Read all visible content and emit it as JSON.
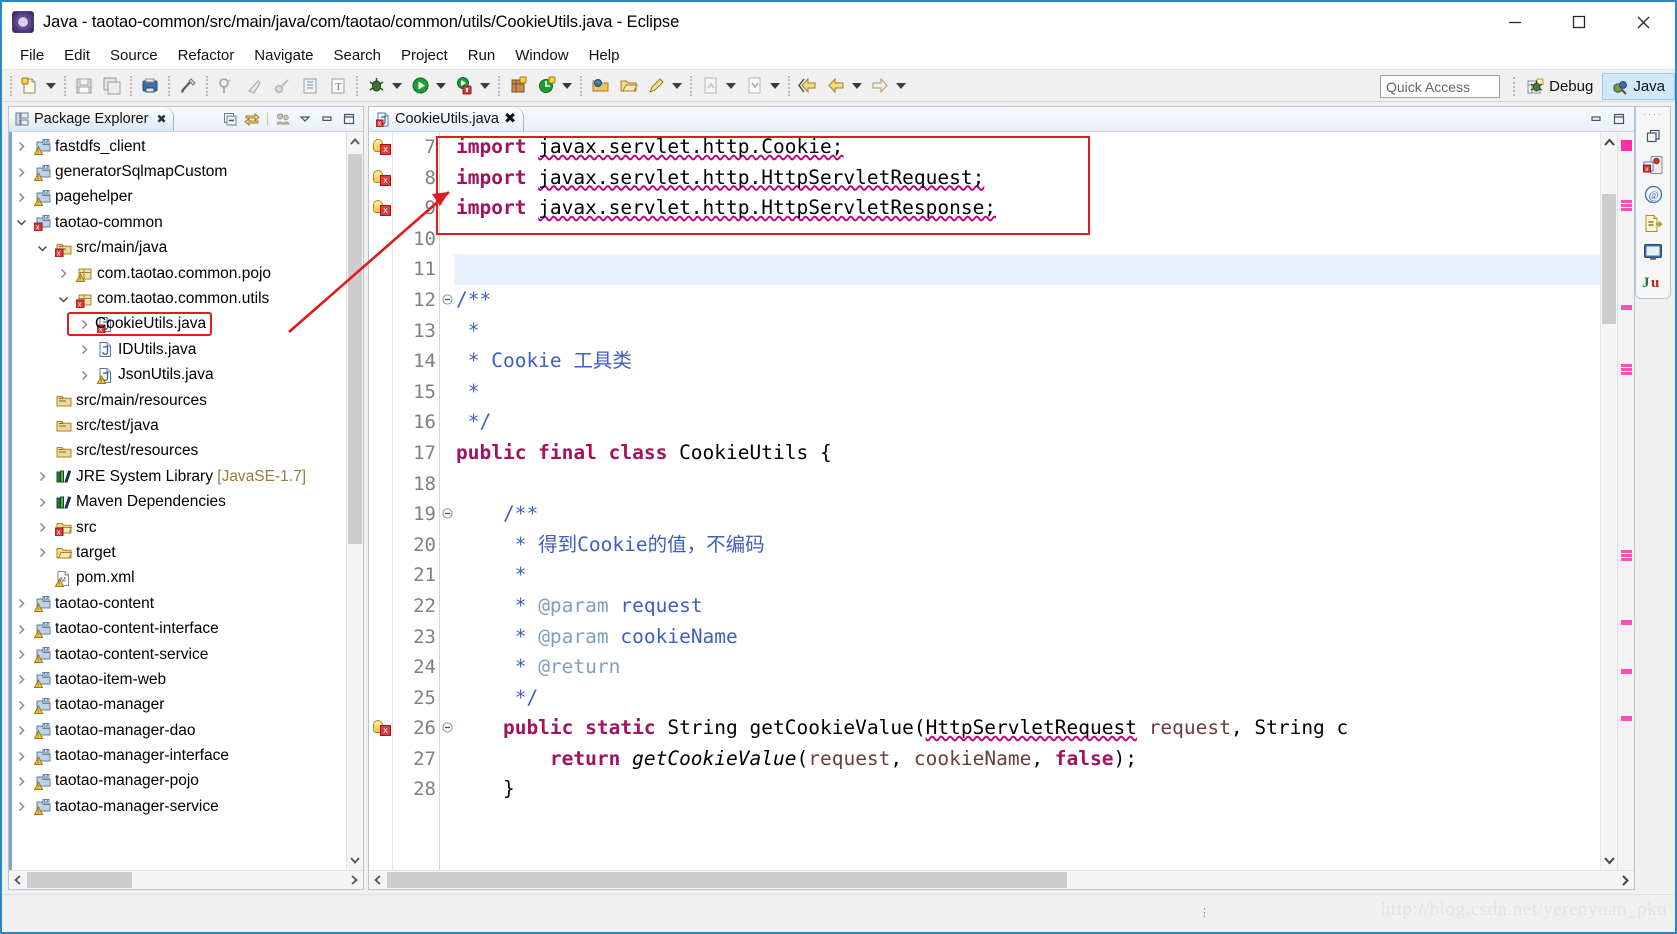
{
  "window": {
    "title": "Java - taotao-common/src/main/java/com/taotao/common/utils/CookieUtils.java - Eclipse",
    "app_icon": "eclipse-icon",
    "minimize": "–",
    "maximize": "□",
    "close": "✕"
  },
  "menubar": {
    "items": [
      "File",
      "Edit",
      "Source",
      "Refactor",
      "Navigate",
      "Search",
      "Project",
      "Run",
      "Window",
      "Help"
    ]
  },
  "toolbar": {
    "quick_access_placeholder": "Quick Access",
    "perspectives": [
      {
        "label": "Debug",
        "icon": "debug-bug-icon",
        "active": false
      },
      {
        "label": "Java",
        "icon": "java-perspective-icon",
        "active": true
      }
    ]
  },
  "explorer": {
    "tab_label": "Package Explorer",
    "tab_close": "✖",
    "tools": [
      "collapse-all-icon",
      "link-with-editor-icon",
      "focus-icon",
      "view-menu-icon",
      "minimize-icon",
      "maximize-icon"
    ],
    "tree": [
      {
        "label": "fastdfs_client",
        "indent": 0,
        "twist": "collapsed",
        "icon": "maven-project-icon",
        "highlight": false
      },
      {
        "label": "generatorSqlmapCustom",
        "indent": 0,
        "twist": "collapsed",
        "icon": "maven-project-icon",
        "highlight": false
      },
      {
        "label": "pagehelper",
        "indent": 0,
        "twist": "collapsed",
        "icon": "maven-project-icon",
        "highlight": false
      },
      {
        "label": "taotao-common",
        "indent": 0,
        "twist": "expanded",
        "icon": "maven-project-error-icon",
        "highlight": false
      },
      {
        "label": "src/main/java",
        "indent": 1,
        "twist": "expanded",
        "icon": "source-folder-error-icon",
        "highlight": false
      },
      {
        "label": "com.taotao.common.pojo",
        "indent": 2,
        "twist": "collapsed",
        "icon": "package-icon",
        "highlight": false
      },
      {
        "label": "com.taotao.common.utils",
        "indent": 2,
        "twist": "expanded",
        "icon": "package-error-icon",
        "highlight": false
      },
      {
        "label": "CookieUtils.java",
        "indent": 3,
        "twist": "collapsed",
        "icon": "java-file-error-icon",
        "highlight": true
      },
      {
        "label": "IDUtils.java",
        "indent": 3,
        "twist": "collapsed",
        "icon": "java-file-icon",
        "highlight": false
      },
      {
        "label": "JsonUtils.java",
        "indent": 3,
        "twist": "collapsed",
        "icon": "java-file-warn-icon",
        "highlight": false
      },
      {
        "label": "src/main/resources",
        "indent": 1,
        "twist": "none",
        "icon": "source-folder-icon",
        "highlight": false
      },
      {
        "label": "src/test/java",
        "indent": 1,
        "twist": "none",
        "icon": "source-folder-icon",
        "highlight": false
      },
      {
        "label": "src/test/resources",
        "indent": 1,
        "twist": "none",
        "icon": "source-folder-icon",
        "highlight": false
      },
      {
        "label": "JRE System Library",
        "suffix": "[JavaSE-1.7]",
        "indent": 1,
        "twist": "collapsed",
        "icon": "library-icon",
        "highlight": false
      },
      {
        "label": "Maven Dependencies",
        "indent": 1,
        "twist": "collapsed",
        "icon": "library-icon",
        "highlight": false
      },
      {
        "label": "src",
        "indent": 1,
        "twist": "collapsed",
        "icon": "folder-error-icon",
        "highlight": false
      },
      {
        "label": "target",
        "indent": 1,
        "twist": "collapsed",
        "icon": "folder-icon",
        "highlight": false
      },
      {
        "label": "pom.xml",
        "indent": 1,
        "twist": "none",
        "icon": "pom-file-icon",
        "highlight": false
      },
      {
        "label": "taotao-content",
        "indent": 0,
        "twist": "collapsed",
        "icon": "maven-project-icon",
        "highlight": false
      },
      {
        "label": "taotao-content-interface",
        "indent": 0,
        "twist": "collapsed",
        "icon": "maven-project-icon",
        "highlight": false
      },
      {
        "label": "taotao-content-service",
        "indent": 0,
        "twist": "collapsed",
        "icon": "maven-project-icon",
        "highlight": false
      },
      {
        "label": "taotao-item-web",
        "indent": 0,
        "twist": "collapsed",
        "icon": "maven-project-icon",
        "highlight": false
      },
      {
        "label": "taotao-manager",
        "indent": 0,
        "twist": "collapsed",
        "icon": "maven-project-icon",
        "highlight": false
      },
      {
        "label": "taotao-manager-dao",
        "indent": 0,
        "twist": "collapsed",
        "icon": "maven-project-icon",
        "highlight": false
      },
      {
        "label": "taotao-manager-interface",
        "indent": 0,
        "twist": "collapsed",
        "icon": "maven-project-icon",
        "highlight": false
      },
      {
        "label": "taotao-manager-pojo",
        "indent": 0,
        "twist": "collapsed",
        "icon": "maven-project-icon",
        "highlight": false
      },
      {
        "label": "taotao-manager-service",
        "indent": 0,
        "twist": "collapsed",
        "icon": "maven-project-icon",
        "highlight": false
      }
    ]
  },
  "editor": {
    "tab_label": "CookieUtils.java",
    "tab_icon": "java-file-error-icon",
    "tab_close": "✖",
    "current_line": 11,
    "first_line": 7,
    "lines": [
      {
        "n": 7,
        "fold": "",
        "marker": "warning-bulb",
        "segments": [
          {
            "t": "import ",
            "c": "kw"
          },
          {
            "t": "javax.servlet.http.Cookie;",
            "c": "plain sq"
          }
        ]
      },
      {
        "n": 8,
        "fold": "",
        "marker": "warning-bulb",
        "segments": [
          {
            "t": "import ",
            "c": "kw"
          },
          {
            "t": "javax.servlet.http.HttpServletRequest;",
            "c": "plain sq"
          }
        ]
      },
      {
        "n": 9,
        "fold": "",
        "marker": "warning-bulb",
        "segments": [
          {
            "t": "import ",
            "c": "kw"
          },
          {
            "t": "javax.servlet.http.HttpServletResponse;",
            "c": "plain sq"
          }
        ]
      },
      {
        "n": 10,
        "fold": "",
        "marker": "",
        "segments": []
      },
      {
        "n": 11,
        "fold": "",
        "marker": "",
        "segments": []
      },
      {
        "n": 12,
        "fold": "-",
        "marker": "",
        "segments": [
          {
            "t": "/**",
            "c": "cmt"
          }
        ]
      },
      {
        "n": 13,
        "fold": "",
        "marker": "",
        "segments": [
          {
            "t": " *",
            "c": "cmt"
          }
        ]
      },
      {
        "n": 14,
        "fold": "",
        "marker": "",
        "segments": [
          {
            "t": " * Cookie 工具类",
            "c": "cmt"
          }
        ]
      },
      {
        "n": 15,
        "fold": "",
        "marker": "",
        "segments": [
          {
            "t": " *",
            "c": "cmt"
          }
        ]
      },
      {
        "n": 16,
        "fold": "",
        "marker": "",
        "segments": [
          {
            "t": " */",
            "c": "cmt"
          }
        ]
      },
      {
        "n": 17,
        "fold": "",
        "marker": "",
        "segments": [
          {
            "t": "public final class ",
            "c": "kw"
          },
          {
            "t": "CookieUtils {",
            "c": "plain"
          }
        ]
      },
      {
        "n": 18,
        "fold": "",
        "marker": "",
        "segments": []
      },
      {
        "n": 19,
        "fold": "-",
        "marker": "",
        "segments": [
          {
            "t": "    /**",
            "c": "cmt"
          }
        ]
      },
      {
        "n": 20,
        "fold": "",
        "marker": "",
        "segments": [
          {
            "t": "     * 得到Cookie的值，不编码",
            "c": "cmt"
          }
        ]
      },
      {
        "n": 21,
        "fold": "",
        "marker": "",
        "segments": [
          {
            "t": "     *",
            "c": "cmt"
          }
        ]
      },
      {
        "n": 22,
        "fold": "",
        "marker": "",
        "segments": [
          {
            "t": "     * ",
            "c": "cmt"
          },
          {
            "t": "@param ",
            "c": "cmtT"
          },
          {
            "t": "request",
            "c": "cmt"
          }
        ]
      },
      {
        "n": 23,
        "fold": "",
        "marker": "",
        "segments": [
          {
            "t": "     * ",
            "c": "cmt"
          },
          {
            "t": "@param ",
            "c": "cmtT"
          },
          {
            "t": "cookieName",
            "c": "cmt"
          }
        ]
      },
      {
        "n": 24,
        "fold": "",
        "marker": "",
        "segments": [
          {
            "t": "     * ",
            "c": "cmt"
          },
          {
            "t": "@return",
            "c": "cmtT"
          }
        ]
      },
      {
        "n": 25,
        "fold": "",
        "marker": "",
        "segments": [
          {
            "t": "     */",
            "c": "cmt"
          }
        ]
      },
      {
        "n": 26,
        "fold": "-",
        "marker": "warning-bulb",
        "segments": [
          {
            "t": "    public static ",
            "c": "kw"
          },
          {
            "t": "String getCookieValue(",
            "c": "plain"
          },
          {
            "t": "HttpServletRequest",
            "c": "plain sq"
          },
          {
            "t": " ",
            "c": "plain"
          },
          {
            "t": "request",
            "c": "parm"
          },
          {
            "t": ", ",
            "c": "plain"
          },
          {
            "t": "String c",
            "c": "plain"
          }
        ]
      },
      {
        "n": 27,
        "fold": "",
        "marker": "",
        "segments": [
          {
            "t": "        ",
            "c": "plain"
          },
          {
            "t": "return ",
            "c": "kw"
          },
          {
            "t": "getCookieValue",
            "c": "plain ital"
          },
          {
            "t": "(",
            "c": "plain"
          },
          {
            "t": "request",
            "c": "parm"
          },
          {
            "t": ", ",
            "c": "plain"
          },
          {
            "t": "cookieName",
            "c": "parm"
          },
          {
            "t": ", ",
            "c": "plain"
          },
          {
            "t": "false",
            "c": "kw"
          },
          {
            "t": ");",
            "c": "plain"
          }
        ]
      },
      {
        "n": 28,
        "fold": "",
        "marker": "",
        "segments": [
          {
            "t": "    }",
            "c": "plain"
          }
        ]
      }
    ],
    "tools": [
      "minimize-icon",
      "maximize-icon"
    ]
  },
  "right_strip": {
    "grip": "····",
    "icons": [
      "restore-icon",
      "outline-view-icon",
      "at-view-icon",
      "snippets-view-icon",
      "console-view-icon",
      "junit-view-icon"
    ]
  },
  "statusbar": {
    "watermark": "http://blog.csdn.net/yerenyuan_pku"
  },
  "colors": {
    "accent": "#2b86c5",
    "highlight_box": "#e01b1b",
    "current_line": "#e8f2fc",
    "keyword": "#a2125f",
    "comment": "#3f5fbf",
    "javadoc_tag": "#7f9fbf",
    "param": "#6a3e3e",
    "marker_pink": "#ff4fb4",
    "perspective_active_bg": "#cfe8fb"
  }
}
